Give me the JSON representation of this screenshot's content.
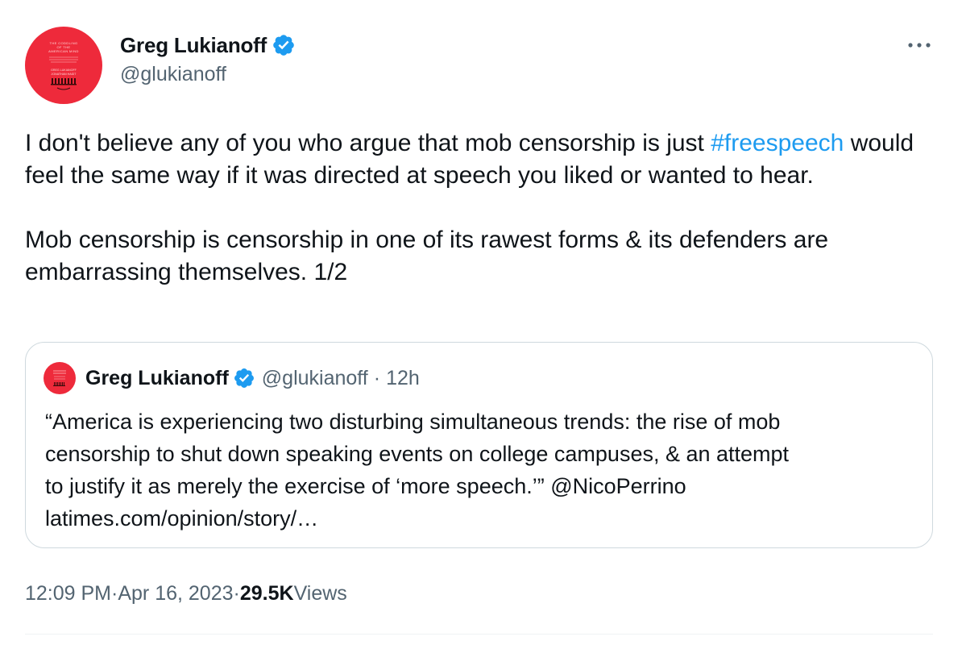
{
  "author": {
    "display_name": "Greg Lukianoff",
    "handle": "@glukianoff",
    "verified": true,
    "avatar_text": [
      "THE CODDLING",
      "OF THE",
      "AMERICAN MIND",
      "GREG LUKIANOFF",
      "JONATHAN HAIDT"
    ]
  },
  "tweet": {
    "paragraph1_before": "I don't believe any of you who argue that mob censorship is just ",
    "hashtag": "#freespeech",
    "paragraph1_after": " would feel the same way if it was directed at speech you liked or wanted to hear.",
    "paragraph2": "Mob censorship is censorship in one of its rawest forms & its defenders are embarrassing themselves. 1/2"
  },
  "quoted": {
    "display_name": "Greg Lukianoff",
    "handle": "@glukianoff",
    "separator": "·",
    "time": "12h",
    "lines": [
      "“America is experiencing two disturbing simultaneous trends: the rise of mob",
      "censorship to shut down speaking events on college campuses, & an attempt",
      "to justify it as merely the exercise of ‘more speech.’” @NicoPerrino",
      "latimes.com/opinion/story/…"
    ]
  },
  "footer": {
    "time": "12:09 PM",
    "date": "Apr 16, 2023",
    "separator": "·",
    "views_count": "29.5K",
    "views_label": "Views"
  },
  "icons": {
    "more": "more-icon",
    "verified": "verified-badge-icon"
  },
  "colors": {
    "accent": "#1d9bf0",
    "text": "#0f1419",
    "secondary": "#536471",
    "border": "#cfd9de",
    "avatar_bg": "#ee2a3b"
  }
}
